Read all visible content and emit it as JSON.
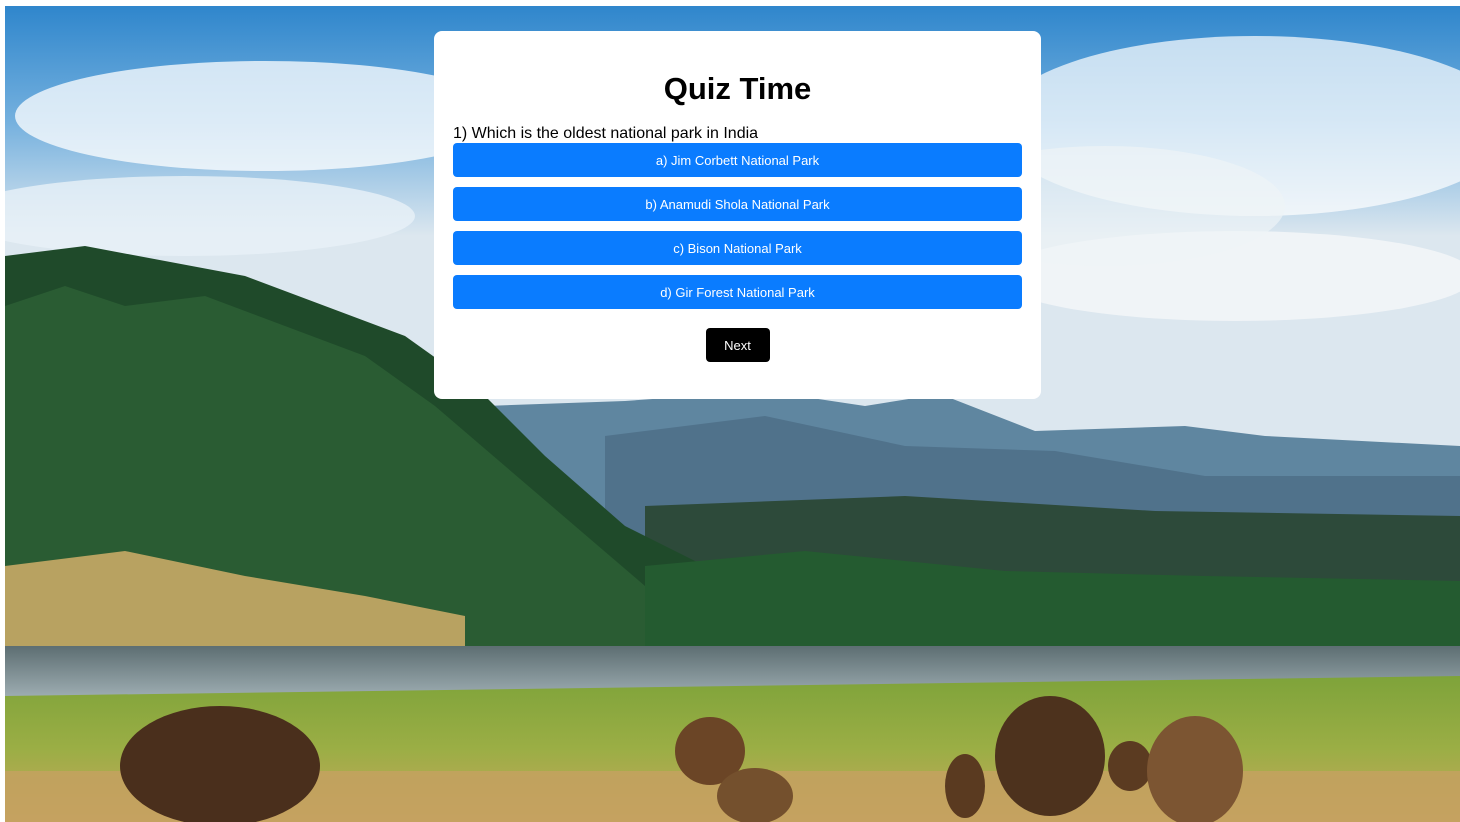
{
  "quiz": {
    "title": "Quiz Time",
    "question": "1) Which is the oldest national park in India",
    "options": [
      "a) Jim Corbett National Park",
      "b) Anamudi Shola National Park",
      "c) Bison National Park",
      "d) Gir Forest National Park"
    ],
    "next_label": "Next"
  },
  "colors": {
    "option_button": "#0a7cff",
    "next_button": "#000000",
    "card": "#ffffff"
  }
}
